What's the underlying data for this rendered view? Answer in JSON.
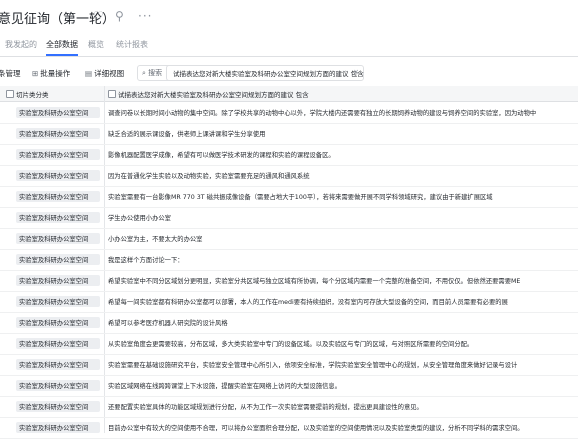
{
  "header": {
    "title": "意见征询（第一轮）",
    "icons": [
      "heart-icon",
      "pin-icon",
      "more-icon"
    ]
  },
  "tabs": [
    {
      "label": "我发起的",
      "active": false
    },
    {
      "label": "全部数据",
      "active": true
    },
    {
      "label": "概览",
      "active": false
    },
    {
      "label": "统计报表",
      "active": false
    }
  ],
  "toolbar": {
    "manage_label": "条管理",
    "batch_label": "批量操作",
    "view_label": "详细视图",
    "search_label": "搜索",
    "filter_text": "试描表达您对新大楼实验室及科研办公室空间规划方面的建议 包含",
    "filter_close": "×"
  },
  "table": {
    "columns": [
      "切片类分类",
      "试描表达您对新大楼实验室及科研办公室空间规划方面的建议 包含"
    ],
    "tag_label": "实验室及科研办公室空间",
    "rows": [
      "调查问卷以长期时间小动物的集中空间。除了学校共享的动物中心以外，学院大楼内还需要有独立的长期饲养动物的建设与饲养空间的实验室，因为动物中",
      "缺乏合适的展示课设备，供老师上课讲课和学生分享使用",
      "影像机器配置医学成像，希望有可以做医学技术研发的课程和实验的课程设备区。",
      "因为在普通化学生实验以及动物实验，实验室需要充足的通风和通风系统",
      "实验室需要有一台影像MR 770 3T 磁共振成像设备（需要占地大于100平），若将来需要做开展不同学科领域研究，建议由于新建扩展区域",
      "学生办公使用小办公室",
      "小办公室为主，不要太大的办公室",
      "我是这样个方面讨论一下：",
      "希望实验室中不同分区域划分更明显，实验室分共区域与独立区域有所协调，每个分区域内需要一个完整的准备空间，不用仅仅。但依然还要需要ME",
      "希望每一间实验室都有科研办公室都可以部署，本人的工作在medi要有持续组织，没有室内可存放大型设备的空间，而目前人员需要有必要的展",
      "希望可以参考医疗机器人研究院的设计风格",
      "从实验室角度会更需要较高，分布区域，多大类实验室中专门的设备区域。以及实验区与专门的区域，与对照区所需要的空间分配。",
      "实验室需要在基础设施研究平台，实验室安全管理中心所引入，依项安全标准，学院实验室安全管理中心的规划，从安全管理角度来做好记录与设计",
      "实验区域网络在线跨跨课堂上下水设施，提醒实验室在网络上访问的大型设施信息。",
      "还要配置实验室具体的功能区域规划进行分配，从不为工作一次实验室需要提前的规划，提出更具建设性的意见。",
      "目前办公室中有较大的空间使用不合理，可以将办公室面积合理分配，以及实验室的空间使用情况以及实验室类型的建议，分析不同学科的需求空间。"
    ]
  }
}
